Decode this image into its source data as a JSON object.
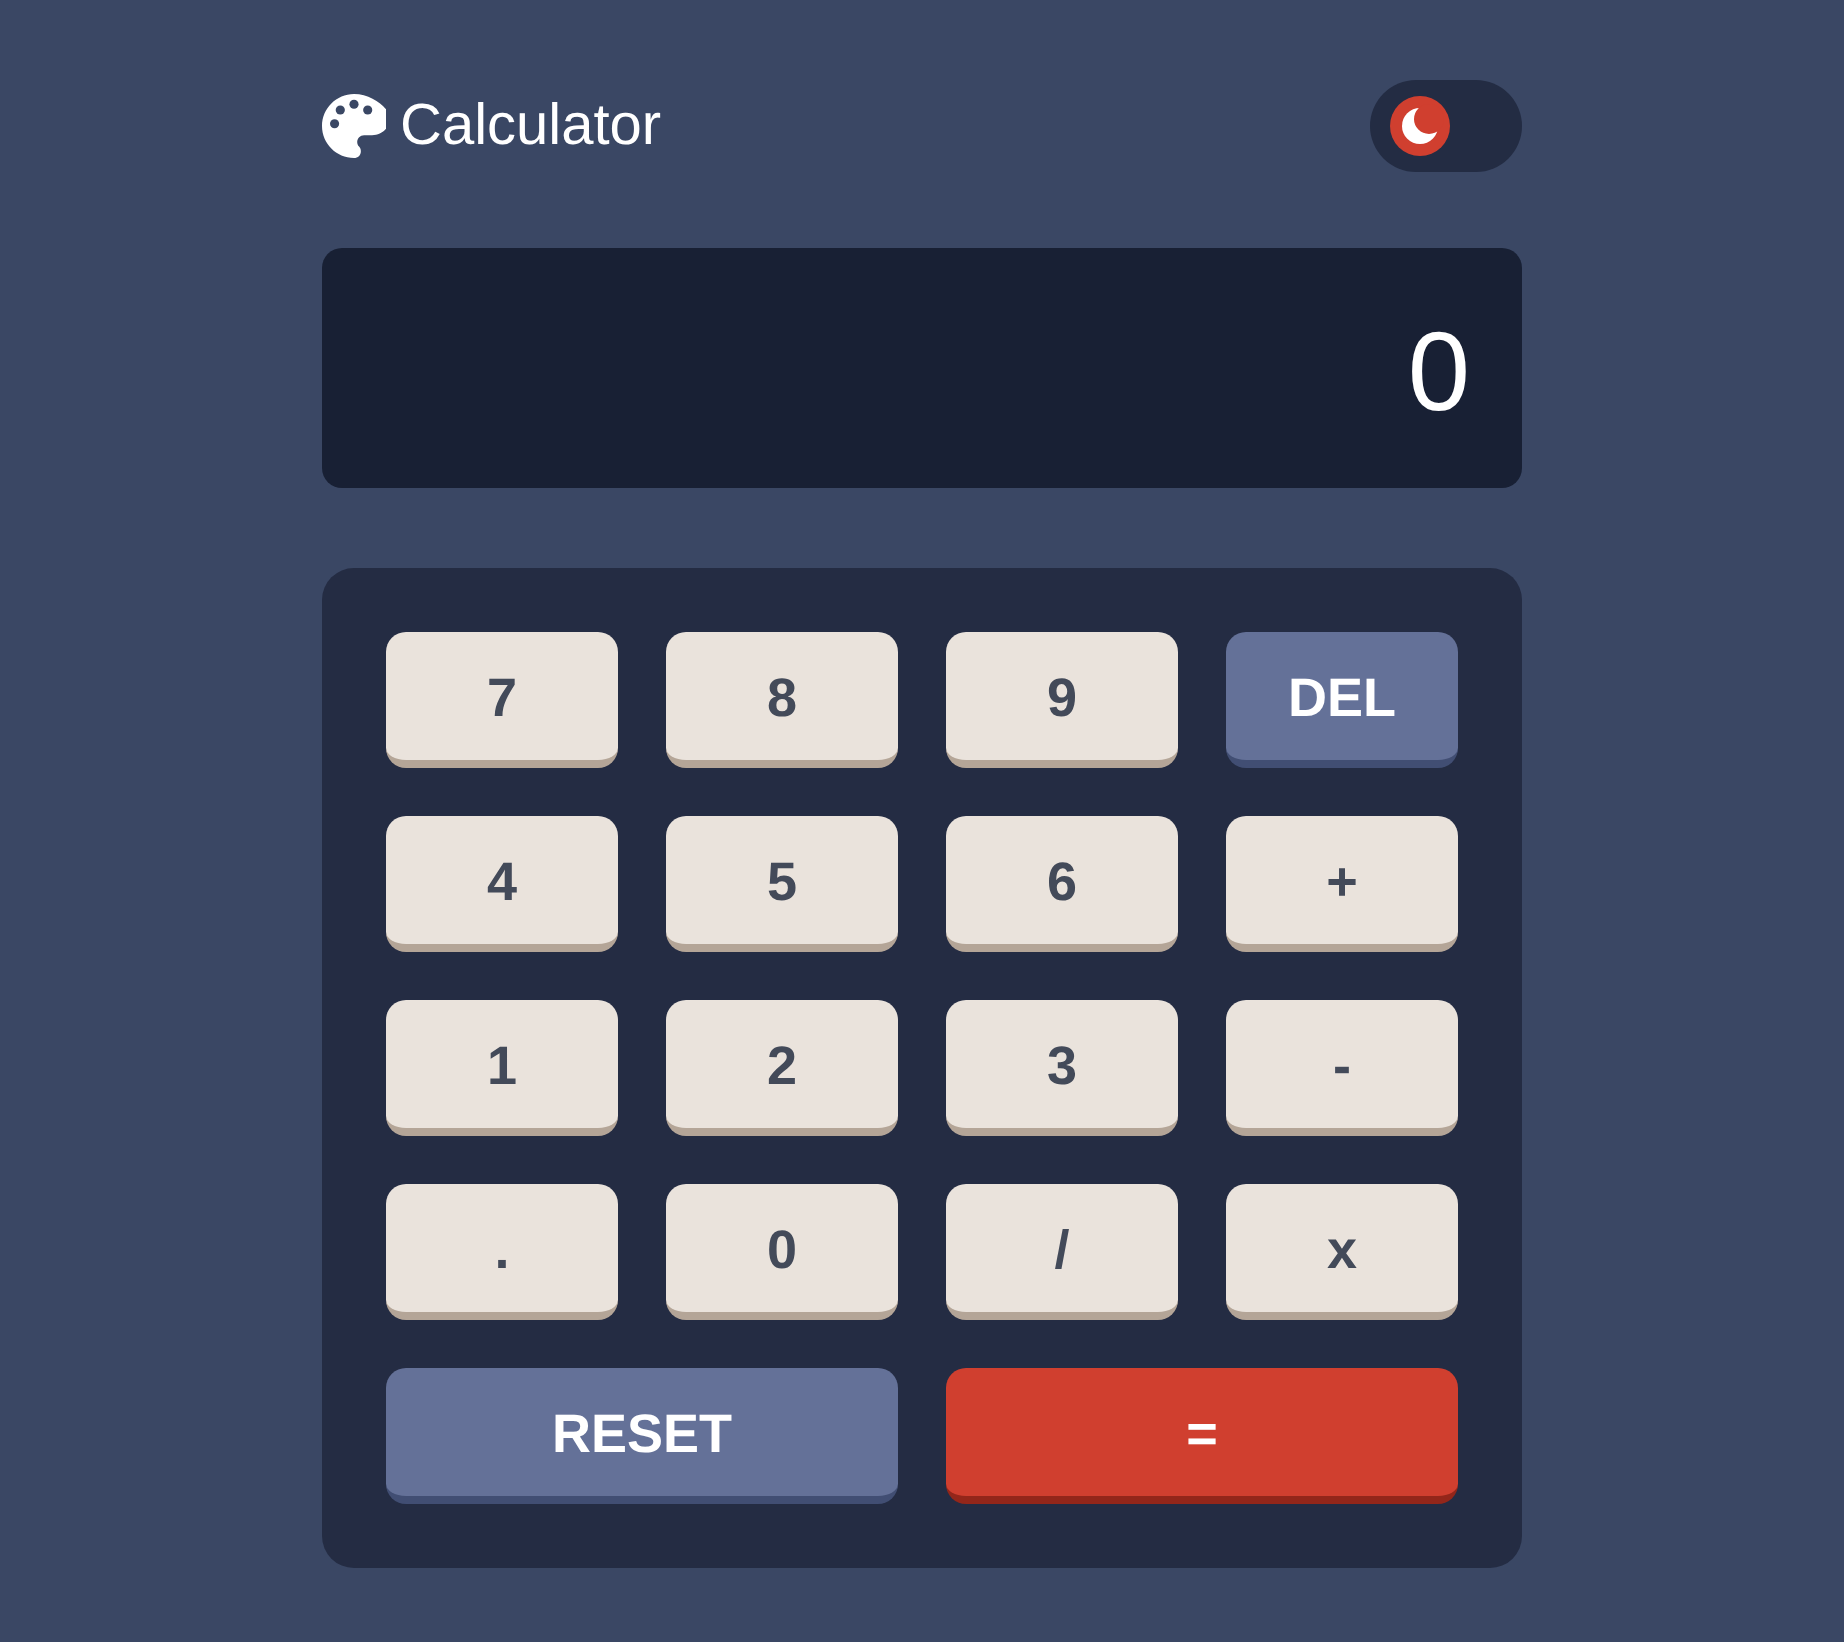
{
  "header": {
    "title": "Calculator",
    "theme_toggle": {
      "on": false
    }
  },
  "display": {
    "value": "0"
  },
  "keypad": {
    "rows": [
      [
        {
          "label": "7",
          "kind": "key"
        },
        {
          "label": "8",
          "kind": "key"
        },
        {
          "label": "9",
          "kind": "key"
        },
        {
          "label": "DEL",
          "kind": "function"
        }
      ],
      [
        {
          "label": "4",
          "kind": "key"
        },
        {
          "label": "5",
          "kind": "key"
        },
        {
          "label": "6",
          "kind": "key"
        },
        {
          "label": "+",
          "kind": "key"
        }
      ],
      [
        {
          "label": "1",
          "kind": "key"
        },
        {
          "label": "2",
          "kind": "key"
        },
        {
          "label": "3",
          "kind": "key"
        },
        {
          "label": "-",
          "kind": "key"
        }
      ],
      [
        {
          "label": ".",
          "kind": "key"
        },
        {
          "label": "0",
          "kind": "key"
        },
        {
          "label": "/",
          "kind": "key"
        },
        {
          "label": "x",
          "kind": "key"
        }
      ],
      [
        {
          "label": "RESET",
          "kind": "function"
        },
        {
          "label": "=",
          "kind": "equals"
        }
      ]
    ]
  }
}
